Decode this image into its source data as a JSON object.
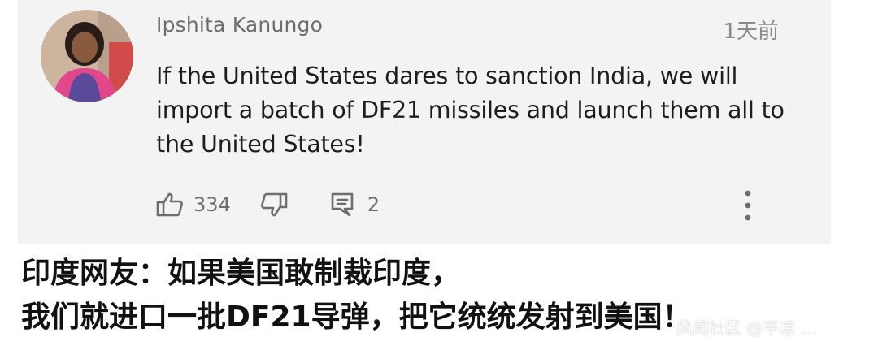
{
  "comment": {
    "author": "Ipshita Kanungo",
    "time": "1天前",
    "text": "If the United States dares to sanction India, we will import a batch of DF21 missiles and launch them all to the United States!",
    "likes": "334",
    "replies": "2",
    "icons": {
      "like": "thumbs-up-icon",
      "dislike": "thumbs-down-icon",
      "reply": "reply-icon",
      "more": "more-vertical-icon"
    }
  },
  "caption": {
    "line1": "印度网友：如果美国敢制裁印度，",
    "line2": "我们就进口一批DF21导弹，把它统统发射到美国！"
  },
  "watermark": "风闻社区 @平凉 …",
  "colors": {
    "card_background": "#f3f3f3",
    "secondary_text": "#6d6d6d",
    "body_text": "#1d1d1d"
  }
}
